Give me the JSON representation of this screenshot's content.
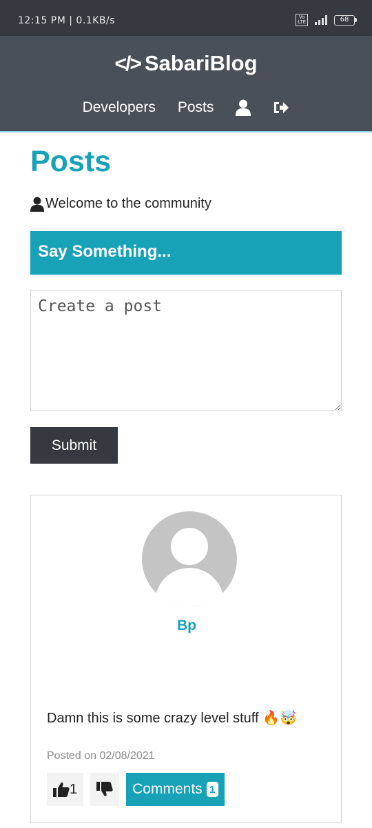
{
  "status_bar": {
    "left_text": "12:15 PM | 0.1KB/s",
    "volte_line1": "Vo",
    "volte_line2": "LTE",
    "battery_level": "68"
  },
  "navbar": {
    "brand_icon": "</>",
    "brand": "SabariBlog",
    "links": {
      "developers": "Developers",
      "posts": "Posts"
    },
    "icons": [
      "user-icon",
      "sign-out-icon"
    ]
  },
  "page": {
    "title": "Posts",
    "lead": "Welcome to the community"
  },
  "post_form": {
    "header": "Say Something...",
    "placeholder": "Create a post",
    "submit_label": "Submit"
  },
  "posts": [
    {
      "username": "Bp",
      "text": "Damn this is some crazy level stuff 🔥🤯",
      "date": "Posted on 02/08/2021",
      "likes": "1",
      "comments_label": "Comments",
      "comments_count": "1"
    }
  ],
  "colors": {
    "primary": "#17a2b8",
    "dark": "#343a40",
    "navbar": "#495057",
    "light": "#f3f3f3"
  }
}
